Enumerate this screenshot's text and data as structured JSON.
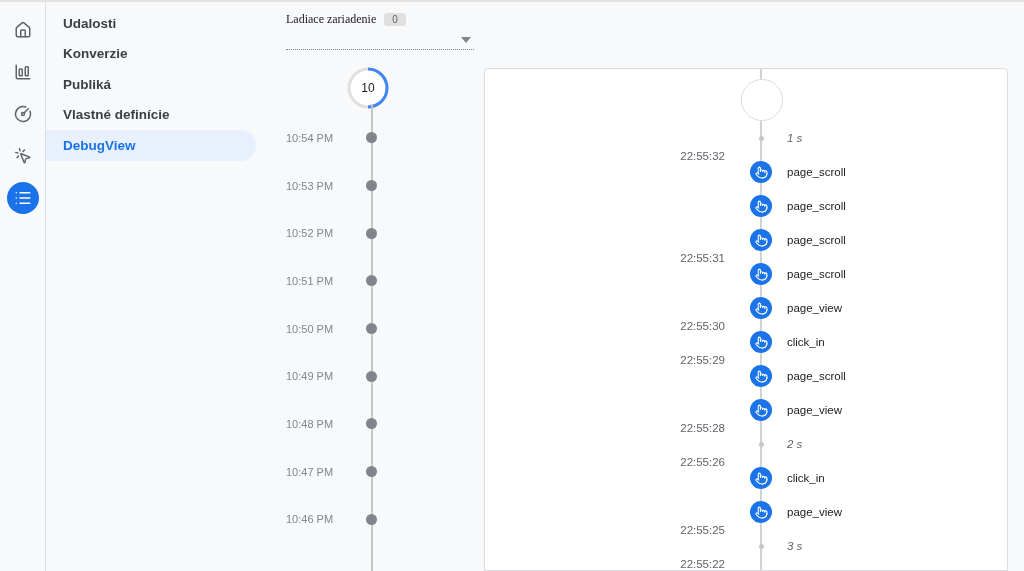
{
  "rail": [
    {
      "kind": "home",
      "selected": false
    },
    {
      "kind": "reports",
      "selected": false
    },
    {
      "kind": "explore",
      "selected": false
    },
    {
      "kind": "advertising",
      "selected": false
    },
    {
      "kind": "configure",
      "selected": true
    }
  ],
  "nav": [
    {
      "label": "Udalosti",
      "selected": false
    },
    {
      "label": "Konverzie",
      "selected": false
    },
    {
      "label": "Publiká",
      "selected": false
    },
    {
      "label": "Vlastné definície",
      "selected": false
    },
    {
      "label": "DebugView",
      "selected": true
    }
  ],
  "device": {
    "label": "Ladiace zariadenie",
    "count": "0"
  },
  "minutes": {
    "counter": "10",
    "level": 0.5,
    "items": [
      "10:54 PM",
      "10:53 PM",
      "10:52 PM",
      "10:51 PM",
      "10:50 PM",
      "10:49 PM",
      "10:48 PM",
      "10:47 PM",
      "10:46 PM"
    ]
  },
  "stream": [
    {
      "kind": "gap",
      "label": "1 s",
      "time": "22:55:32"
    },
    {
      "kind": "event",
      "label": "page_scroll"
    },
    {
      "kind": "event",
      "label": "page_scroll"
    },
    {
      "kind": "event",
      "label": "page_scroll",
      "time": "22:55:31"
    },
    {
      "kind": "event",
      "label": "page_scroll"
    },
    {
      "kind": "event",
      "label": "page_view",
      "time": "22:55:30"
    },
    {
      "kind": "event",
      "label": "click_in",
      "time": "22:55:29"
    },
    {
      "kind": "event",
      "label": "page_scroll"
    },
    {
      "kind": "event",
      "label": "page_view",
      "time": "22:55:28"
    },
    {
      "kind": "gap",
      "label": "2 s",
      "time": "22:55:26"
    },
    {
      "kind": "event",
      "label": "click_in"
    },
    {
      "kind": "event",
      "label": "page_view",
      "time": "22:55:25"
    },
    {
      "kind": "gap",
      "label": "3 s",
      "time": "22:55:22"
    }
  ]
}
